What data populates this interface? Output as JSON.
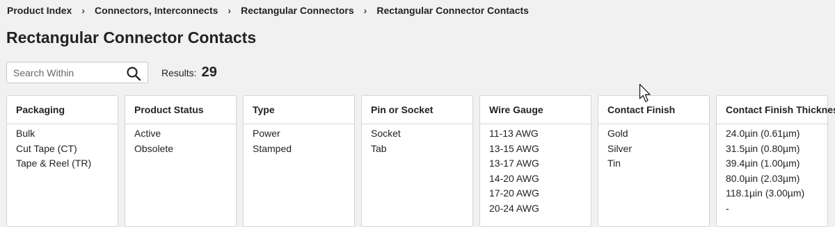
{
  "breadcrumb": [
    "Product Index",
    "Connectors, Interconnects",
    "Rectangular Connectors",
    "Rectangular Connector Contacts"
  ],
  "breadcrumb_separator": "›",
  "page_title": "Rectangular Connector Contacts",
  "search": {
    "placeholder": "Search Within",
    "value": ""
  },
  "results": {
    "label": "Results:",
    "count": "29"
  },
  "filters": [
    {
      "title": "Packaging",
      "options": [
        "Bulk",
        "Cut Tape (CT)",
        "Tape & Reel (TR)"
      ]
    },
    {
      "title": "Product Status",
      "options": [
        "Active",
        "Obsolete"
      ]
    },
    {
      "title": "Type",
      "options": [
        "Power",
        "Stamped"
      ]
    },
    {
      "title": "Pin or Socket",
      "options": [
        "Socket",
        "Tab"
      ]
    },
    {
      "title": "Wire Gauge",
      "options": [
        "11-13 AWG",
        "13-15 AWG",
        "13-17 AWG",
        "14-20 AWG",
        "17-20 AWG",
        "20-24 AWG"
      ]
    },
    {
      "title": "Contact Finish",
      "options": [
        "Gold",
        "Silver",
        "Tin"
      ]
    },
    {
      "title": "Contact Finish Thickness",
      "options": [
        "24.0µin (0.61µm)",
        "31.5µin (0.80µm)",
        "39.4µin (1.00µm)",
        "80.0µin (2.03µm)",
        "118.1µin (3.00µm)",
        "-"
      ]
    }
  ],
  "icons": {
    "search": "search-icon",
    "cursor": "mouse-pointer-icon"
  }
}
